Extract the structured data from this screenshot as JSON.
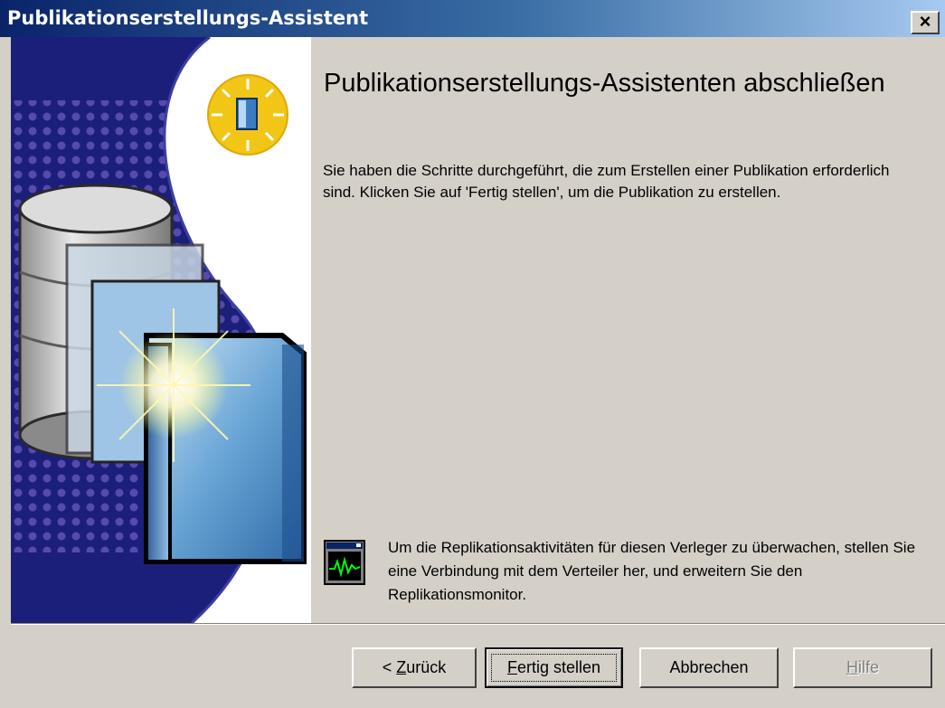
{
  "window": {
    "title": "Publikationserstellungs-Assistent",
    "close_label": "×"
  },
  "main": {
    "heading": "Publikationserstellungs-Assistenten abschließen",
    "description": "Sie haben die Schritte durchgeführt, die zum Erstellen einer Publikation erforderlich sind. Klicken Sie auf 'Fertig stellen', um die Publikation zu erstellen.",
    "monitor_note": "Um die Replikationsaktivitäten für diesen Verleger zu überwachen, stellen Sie eine Verbindung mit dem Verteiler her, und erweitern Sie den Replikationsmonitor."
  },
  "buttons": {
    "back_prefix": "< ",
    "back_accel": "Z",
    "back_rest": "urück",
    "finish_accel": "F",
    "finish_rest": "ertig stellen",
    "cancel": "Abbrechen",
    "help_accel": "H",
    "help_rest": "ilfe"
  },
  "icons": {
    "banner": "database-book-illustration",
    "badge": "book-sun-icon",
    "monitor": "performance-monitor-icon"
  },
  "colors": {
    "title_bar_start": "#0a246a",
    "title_bar_end": "#a6caf0",
    "dialog_face": "#d4d0c8",
    "banner_navy": "#1b1f7a"
  }
}
